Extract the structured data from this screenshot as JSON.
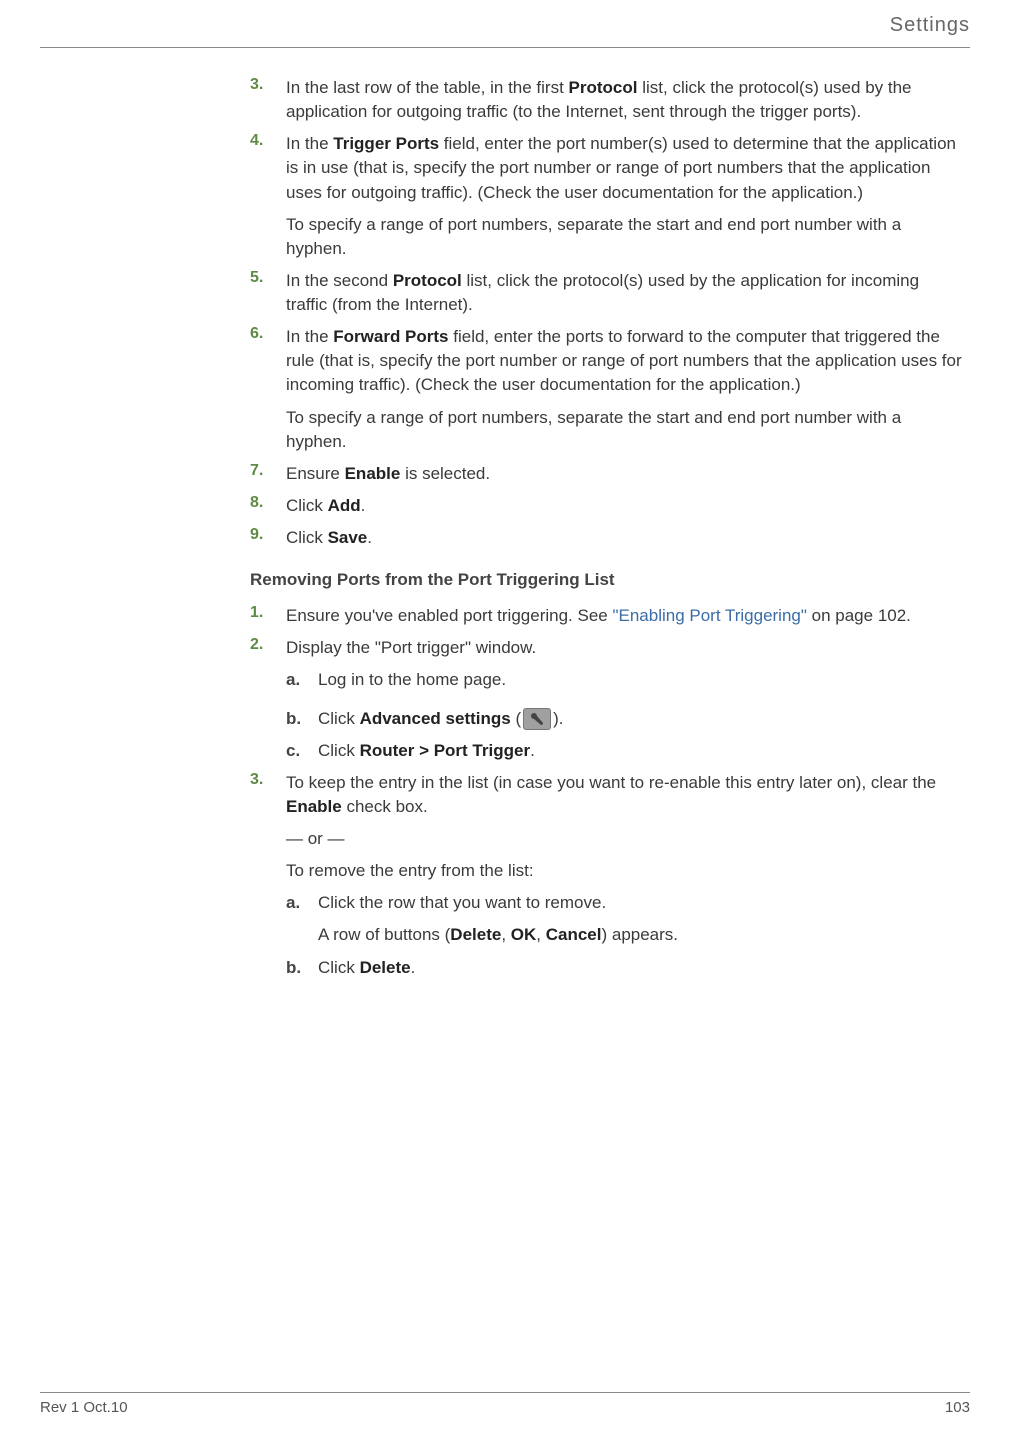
{
  "header": {
    "section": "Settings"
  },
  "steps_top": [
    {
      "marker": "3.",
      "segments": [
        {
          "t": "In the last row of the table, in the first "
        },
        {
          "t": "Protocol",
          "b": true
        },
        {
          "t": " list, click the protocol(s) used by the application for outgoing traffic (to the Internet, sent through the trigger ports)."
        }
      ]
    },
    {
      "marker": "4.",
      "segments": [
        {
          "t": "In the "
        },
        {
          "t": "Trigger Ports",
          "b": true
        },
        {
          "t": " field, enter the port number(s) used to determine that the application is in use (that is, specify the port number or range of port numbers that the application uses for outgoing traffic). (Check the user documentation for the application.)"
        }
      ],
      "cont": "To specify a range of port numbers, separate the start and end port number with a hyphen."
    },
    {
      "marker": "5.",
      "segments": [
        {
          "t": "In the second "
        },
        {
          "t": "Protocol",
          "b": true
        },
        {
          "t": " list, click the protocol(s) used by the application for incoming traffic (from the Internet)."
        }
      ]
    },
    {
      "marker": "6.",
      "segments": [
        {
          "t": "In the "
        },
        {
          "t": "Forward Ports",
          "b": true
        },
        {
          "t": " field, enter the ports to forward to the computer that triggered the rule (that is, specify the port number or range of port numbers that the application uses for incoming traffic). (Check the user documentation for the application.)"
        }
      ],
      "cont": "To specify a range of port numbers, separate the start and end port number with a hyphen."
    },
    {
      "marker": "7.",
      "segments": [
        {
          "t": "Ensure "
        },
        {
          "t": "Enable",
          "b": true
        },
        {
          "t": " is selected."
        }
      ]
    },
    {
      "marker": "8.",
      "segments": [
        {
          "t": "Click "
        },
        {
          "t": "Add",
          "b": true
        },
        {
          "t": "."
        }
      ]
    },
    {
      "marker": "9.",
      "segments": [
        {
          "t": "Click "
        },
        {
          "t": "Save",
          "b": true
        },
        {
          "t": "."
        }
      ]
    }
  ],
  "subheading": "Removing Ports from the Port Triggering List",
  "steps_bottom": {
    "s1": {
      "marker": "1.",
      "pre": "Ensure you've enabled port triggering. See ",
      "link": "\"Enabling Port Triggering\"",
      "post": " on page 102."
    },
    "s2": {
      "marker": "2.",
      "text": "Display the \"Port trigger\" window."
    },
    "s2a": {
      "marker": "a.",
      "text": "Log in to the home page."
    },
    "s2b": {
      "marker": "b.",
      "pre": "Click ",
      "bold": "Advanced settings",
      "post_open": " (",
      "post_close": ")."
    },
    "s2c": {
      "marker": "c.",
      "pre": "Click ",
      "bold": "Router > Port Trigger",
      "post": "."
    },
    "s3": {
      "marker": "3.",
      "pre": "To keep the entry in the list (in case you want to re-enable this entry later on), clear the ",
      "bold": "Enable",
      "post": " check box.",
      "or": "— or —",
      "removeIntro": "To remove the entry from the list:"
    },
    "s3a": {
      "marker": "a.",
      "text": "Click the row that you want to remove."
    },
    "s3a_note": {
      "pre": "A row of buttons (",
      "b1": "Delete",
      "sep1": ", ",
      "b2": "OK",
      "sep2": ", ",
      "b3": "Cancel",
      "post": ") appears."
    },
    "s3b": {
      "marker": "b.",
      "pre": "Click ",
      "bold": "Delete",
      "post": "."
    }
  },
  "footer": {
    "left": "Rev 1  Oct.10",
    "right": "103"
  }
}
